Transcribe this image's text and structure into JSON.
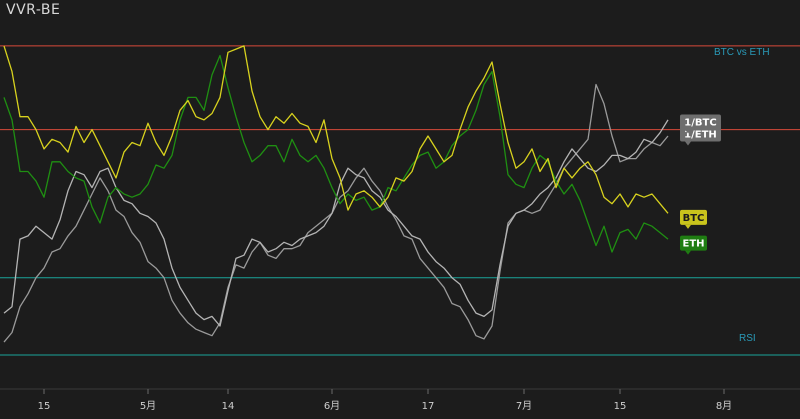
{
  "header": {
    "title": "VVR-BE"
  },
  "colors": {
    "background": "#1c1c1c",
    "btc": "#d8d21e",
    "eth": "#1f8f12",
    "inv_eth": "#9a9a9a",
    "inv_btc": "#b4b4b4",
    "upper_band": "#d84a3a",
    "lower_band": "#1aa39a",
    "tick_text": "#cfcfcf",
    "annotation_text": "#2a9ab8"
  },
  "chart_data": {
    "type": "line",
    "title": "VVR-BE",
    "annotations": [
      "BTC vs ETH",
      "RSI"
    ],
    "xlabel": "",
    "ylabel": "",
    "x_tick_labels": [
      "15",
      "5月",
      "14",
      "6月",
      "17",
      "7月",
      "15",
      "8月"
    ],
    "x_tick_index": [
      5,
      18,
      28,
      41,
      53,
      65,
      77,
      90
    ],
    "n_points": 84,
    "ylim": [
      0,
      100
    ],
    "reference_lines": {
      "upper": 96,
      "upper2": 70,
      "lower": 24,
      "bottom": 0
    },
    "series": [
      {
        "name": "BTC",
        "label": "BTC",
        "color": "#d8d21e",
        "values": [
          96,
          88,
          74,
          74,
          70,
          64,
          67,
          66,
          63,
          71,
          66,
          70,
          65,
          60,
          55,
          63,
          66,
          65,
          72,
          66,
          62,
          68,
          76,
          79,
          74,
          73,
          75,
          80,
          94,
          95,
          96,
          82,
          74,
          70,
          74,
          72,
          75,
          72,
          71,
          66,
          73,
          61,
          55,
          45,
          50,
          51,
          49,
          46,
          49,
          55,
          54,
          57,
          64,
          68,
          64,
          60,
          62,
          70,
          77,
          82,
          86,
          91,
          78,
          66,
          58,
          60,
          64,
          57,
          61,
          52,
          58,
          55,
          58,
          60,
          56,
          49,
          47,
          50,
          46,
          50,
          49,
          50,
          47,
          44
        ]
      },
      {
        "name": "ETH",
        "label": "ETH",
        "color": "#1f8f12",
        "values": [
          80,
          73,
          57,
          57,
          54,
          49,
          60,
          60,
          57,
          55,
          54,
          46,
          41,
          49,
          52,
          50,
          49,
          50,
          53,
          59,
          58,
          62,
          73,
          80,
          80,
          76,
          87,
          93,
          83,
          74,
          66,
          60,
          62,
          65,
          65,
          60,
          67,
          62,
          60,
          62,
          58,
          52,
          47,
          50,
          48,
          49,
          45,
          46,
          52,
          51,
          55,
          59,
          62,
          63,
          58,
          60,
          65,
          68,
          70,
          76,
          84,
          88,
          74,
          56,
          53,
          52,
          58,
          62,
          60,
          54,
          50,
          53,
          48,
          41,
          34,
          40,
          32,
          38,
          39,
          36,
          41,
          40,
          38,
          36
        ]
      },
      {
        "name": "1/ETH",
        "label": "1/ETH",
        "color": "#9a9a9a",
        "values": [
          4,
          7,
          15,
          19,
          24,
          27,
          32,
          33,
          37,
          40,
          45,
          50,
          55,
          51,
          45,
          43,
          38,
          35,
          29,
          27,
          24,
          17,
          13,
          10,
          8,
          7,
          6,
          10,
          21,
          28,
          27,
          32,
          35,
          31,
          30,
          33,
          33,
          34,
          38,
          40,
          42,
          44,
          49,
          51,
          55,
          58,
          54,
          51,
          46,
          42,
          37,
          36,
          30,
          27,
          24,
          21,
          16,
          15,
          11,
          6,
          5,
          9,
          26,
          41,
          44,
          45,
          44,
          45,
          49,
          53,
          58,
          61,
          64,
          67,
          84,
          78,
          68,
          60,
          61,
          61,
          64,
          66,
          65,
          68
        ]
      },
      {
        "name": "1/BTC",
        "label": "1/BTC",
        "color": "#b4b4b4",
        "values": [
          13,
          15,
          36,
          37,
          40,
          38,
          36,
          42,
          51,
          57,
          56,
          52,
          57,
          58,
          52,
          48,
          47,
          44,
          43,
          41,
          36,
          27,
          21,
          17,
          13,
          11,
          12,
          9,
          20,
          30,
          31,
          36,
          35,
          32,
          33,
          35,
          34,
          36,
          37,
          38,
          40,
          44,
          53,
          58,
          56,
          55,
          51,
          49,
          45,
          43,
          40,
          37,
          36,
          32,
          29,
          27,
          24,
          22,
          17,
          13,
          12,
          14,
          28,
          40,
          44,
          45,
          47,
          50,
          52,
          55,
          60,
          64,
          61,
          58,
          57,
          59,
          62,
          62,
          61,
          63,
          67,
          66,
          69,
          73
        ]
      }
    ]
  }
}
